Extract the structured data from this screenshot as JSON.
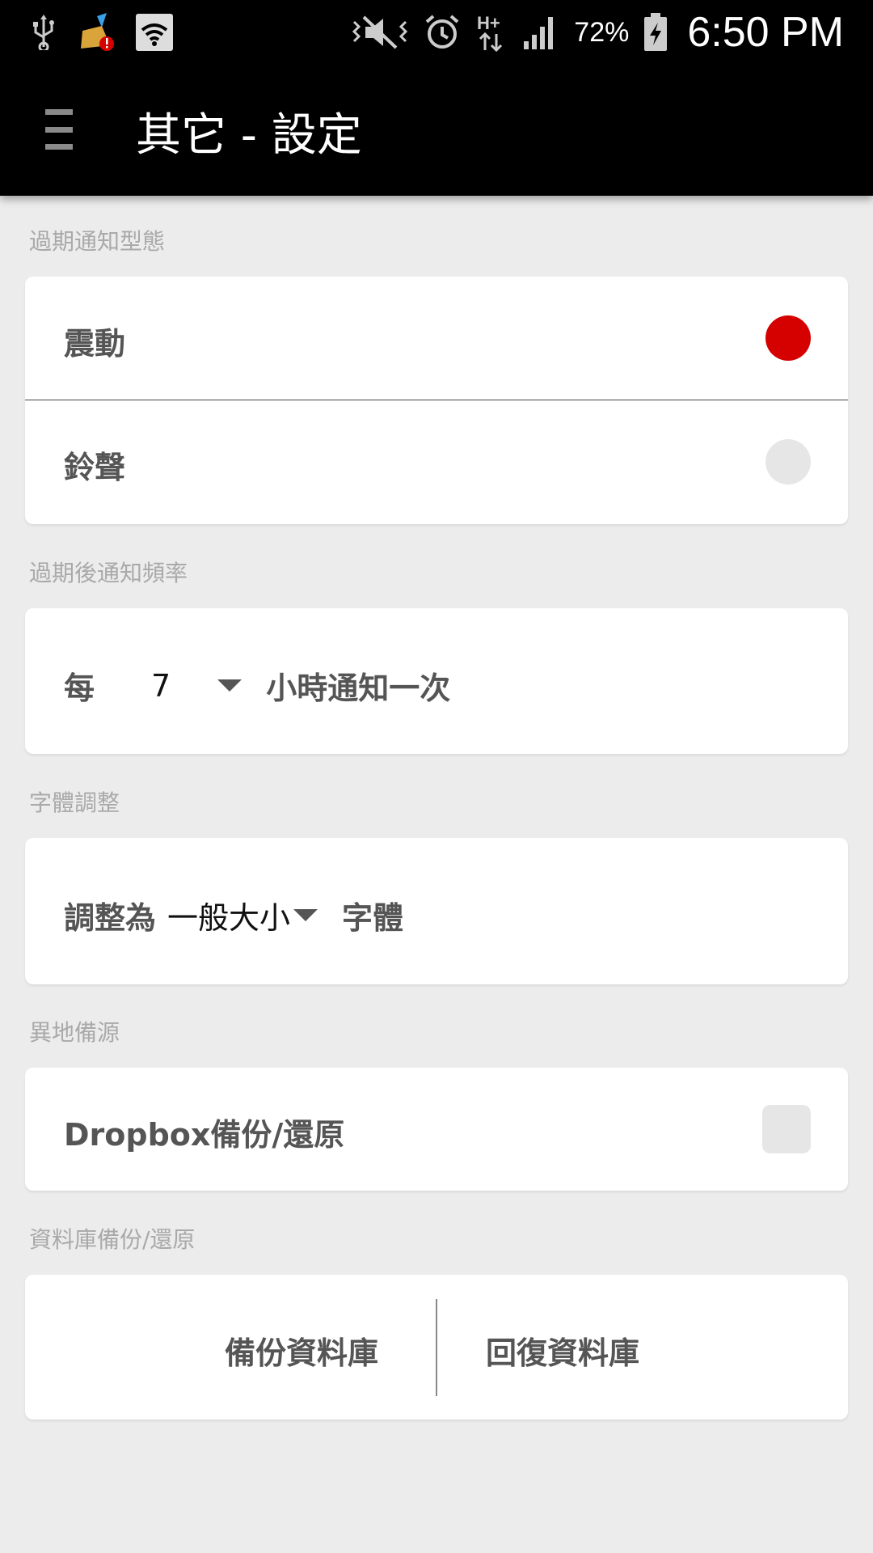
{
  "status_bar": {
    "battery_percent": "72%",
    "time": "6:50 PM",
    "icons": [
      "usb-icon",
      "cleaner-icon",
      "wifi-icon",
      "vibrate-mute-icon",
      "alarm-icon",
      "hplus-data-icon",
      "signal-icon",
      "battery-charging-icon"
    ]
  },
  "app_bar": {
    "title": "其它 - 設定",
    "menu_icon": "hamburger-menu-icon"
  },
  "sections": {
    "notify_type": {
      "label": "過期通知型態",
      "options": [
        {
          "label": "震動",
          "selected": true
        },
        {
          "label": "鈴聲",
          "selected": false
        }
      ]
    },
    "frequency": {
      "label": "過期後通知頻率",
      "prefix": "每",
      "value": "7",
      "suffix": "小時通知一次"
    },
    "font": {
      "label": "字體調整",
      "prefix": "調整為",
      "value": "一般大小",
      "suffix": "字體"
    },
    "remote_backup": {
      "label": "異地備源",
      "option_label": "Dropbox備份/還原",
      "checked": false
    },
    "db_backup": {
      "label": "資料庫備份/還原",
      "backup_button": "備份資料庫",
      "restore_button": "回復資料庫"
    }
  },
  "colors": {
    "accent": "#d50000",
    "background": "#ececec",
    "app_bar": "#000000"
  }
}
